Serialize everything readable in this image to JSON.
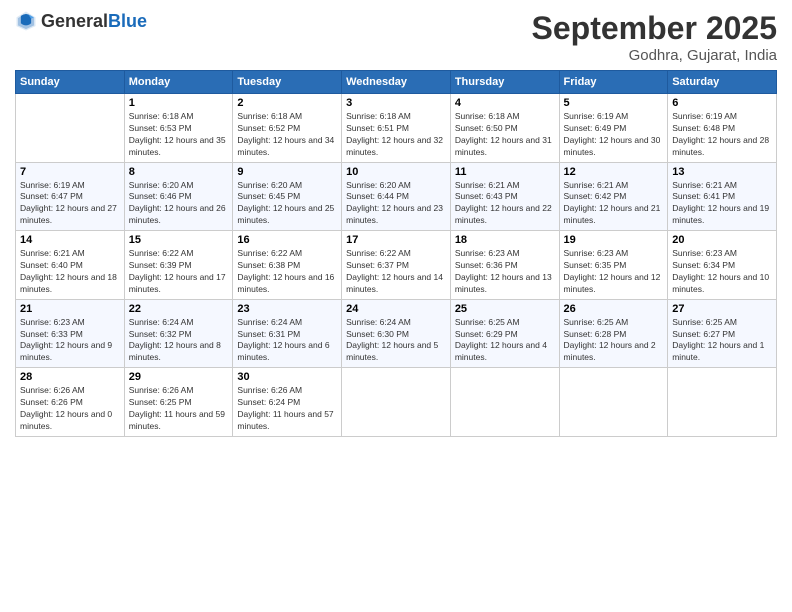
{
  "logo": {
    "general": "General",
    "blue": "Blue"
  },
  "title": "September 2025",
  "subtitle": "Godhra, Gujarat, India",
  "weekdays": [
    "Sunday",
    "Monday",
    "Tuesday",
    "Wednesday",
    "Thursday",
    "Friday",
    "Saturday"
  ],
  "weeks": [
    [
      {
        "day": "",
        "sunrise": "",
        "sunset": "",
        "daylight": ""
      },
      {
        "day": "1",
        "sunrise": "Sunrise: 6:18 AM",
        "sunset": "Sunset: 6:53 PM",
        "daylight": "Daylight: 12 hours and 35 minutes."
      },
      {
        "day": "2",
        "sunrise": "Sunrise: 6:18 AM",
        "sunset": "Sunset: 6:52 PM",
        "daylight": "Daylight: 12 hours and 34 minutes."
      },
      {
        "day": "3",
        "sunrise": "Sunrise: 6:18 AM",
        "sunset": "Sunset: 6:51 PM",
        "daylight": "Daylight: 12 hours and 32 minutes."
      },
      {
        "day": "4",
        "sunrise": "Sunrise: 6:18 AM",
        "sunset": "Sunset: 6:50 PM",
        "daylight": "Daylight: 12 hours and 31 minutes."
      },
      {
        "day": "5",
        "sunrise": "Sunrise: 6:19 AM",
        "sunset": "Sunset: 6:49 PM",
        "daylight": "Daylight: 12 hours and 30 minutes."
      },
      {
        "day": "6",
        "sunrise": "Sunrise: 6:19 AM",
        "sunset": "Sunset: 6:48 PM",
        "daylight": "Daylight: 12 hours and 28 minutes."
      }
    ],
    [
      {
        "day": "7",
        "sunrise": "Sunrise: 6:19 AM",
        "sunset": "Sunset: 6:47 PM",
        "daylight": "Daylight: 12 hours and 27 minutes."
      },
      {
        "day": "8",
        "sunrise": "Sunrise: 6:20 AM",
        "sunset": "Sunset: 6:46 PM",
        "daylight": "Daylight: 12 hours and 26 minutes."
      },
      {
        "day": "9",
        "sunrise": "Sunrise: 6:20 AM",
        "sunset": "Sunset: 6:45 PM",
        "daylight": "Daylight: 12 hours and 25 minutes."
      },
      {
        "day": "10",
        "sunrise": "Sunrise: 6:20 AM",
        "sunset": "Sunset: 6:44 PM",
        "daylight": "Daylight: 12 hours and 23 minutes."
      },
      {
        "day": "11",
        "sunrise": "Sunrise: 6:21 AM",
        "sunset": "Sunset: 6:43 PM",
        "daylight": "Daylight: 12 hours and 22 minutes."
      },
      {
        "day": "12",
        "sunrise": "Sunrise: 6:21 AM",
        "sunset": "Sunset: 6:42 PM",
        "daylight": "Daylight: 12 hours and 21 minutes."
      },
      {
        "day": "13",
        "sunrise": "Sunrise: 6:21 AM",
        "sunset": "Sunset: 6:41 PM",
        "daylight": "Daylight: 12 hours and 19 minutes."
      }
    ],
    [
      {
        "day": "14",
        "sunrise": "Sunrise: 6:21 AM",
        "sunset": "Sunset: 6:40 PM",
        "daylight": "Daylight: 12 hours and 18 minutes."
      },
      {
        "day": "15",
        "sunrise": "Sunrise: 6:22 AM",
        "sunset": "Sunset: 6:39 PM",
        "daylight": "Daylight: 12 hours and 17 minutes."
      },
      {
        "day": "16",
        "sunrise": "Sunrise: 6:22 AM",
        "sunset": "Sunset: 6:38 PM",
        "daylight": "Daylight: 12 hours and 16 minutes."
      },
      {
        "day": "17",
        "sunrise": "Sunrise: 6:22 AM",
        "sunset": "Sunset: 6:37 PM",
        "daylight": "Daylight: 12 hours and 14 minutes."
      },
      {
        "day": "18",
        "sunrise": "Sunrise: 6:23 AM",
        "sunset": "Sunset: 6:36 PM",
        "daylight": "Daylight: 12 hours and 13 minutes."
      },
      {
        "day": "19",
        "sunrise": "Sunrise: 6:23 AM",
        "sunset": "Sunset: 6:35 PM",
        "daylight": "Daylight: 12 hours and 12 minutes."
      },
      {
        "day": "20",
        "sunrise": "Sunrise: 6:23 AM",
        "sunset": "Sunset: 6:34 PM",
        "daylight": "Daylight: 12 hours and 10 minutes."
      }
    ],
    [
      {
        "day": "21",
        "sunrise": "Sunrise: 6:23 AM",
        "sunset": "Sunset: 6:33 PM",
        "daylight": "Daylight: 12 hours and 9 minutes."
      },
      {
        "day": "22",
        "sunrise": "Sunrise: 6:24 AM",
        "sunset": "Sunset: 6:32 PM",
        "daylight": "Daylight: 12 hours and 8 minutes."
      },
      {
        "day": "23",
        "sunrise": "Sunrise: 6:24 AM",
        "sunset": "Sunset: 6:31 PM",
        "daylight": "Daylight: 12 hours and 6 minutes."
      },
      {
        "day": "24",
        "sunrise": "Sunrise: 6:24 AM",
        "sunset": "Sunset: 6:30 PM",
        "daylight": "Daylight: 12 hours and 5 minutes."
      },
      {
        "day": "25",
        "sunrise": "Sunrise: 6:25 AM",
        "sunset": "Sunset: 6:29 PM",
        "daylight": "Daylight: 12 hours and 4 minutes."
      },
      {
        "day": "26",
        "sunrise": "Sunrise: 6:25 AM",
        "sunset": "Sunset: 6:28 PM",
        "daylight": "Daylight: 12 hours and 2 minutes."
      },
      {
        "day": "27",
        "sunrise": "Sunrise: 6:25 AM",
        "sunset": "Sunset: 6:27 PM",
        "daylight": "Daylight: 12 hours and 1 minute."
      }
    ],
    [
      {
        "day": "28",
        "sunrise": "Sunrise: 6:26 AM",
        "sunset": "Sunset: 6:26 PM",
        "daylight": "Daylight: 12 hours and 0 minutes."
      },
      {
        "day": "29",
        "sunrise": "Sunrise: 6:26 AM",
        "sunset": "Sunset: 6:25 PM",
        "daylight": "Daylight: 11 hours and 59 minutes."
      },
      {
        "day": "30",
        "sunrise": "Sunrise: 6:26 AM",
        "sunset": "Sunset: 6:24 PM",
        "daylight": "Daylight: 11 hours and 57 minutes."
      },
      {
        "day": "",
        "sunrise": "",
        "sunset": "",
        "daylight": ""
      },
      {
        "day": "",
        "sunrise": "",
        "sunset": "",
        "daylight": ""
      },
      {
        "day": "",
        "sunrise": "",
        "sunset": "",
        "daylight": ""
      },
      {
        "day": "",
        "sunrise": "",
        "sunset": "",
        "daylight": ""
      }
    ]
  ]
}
